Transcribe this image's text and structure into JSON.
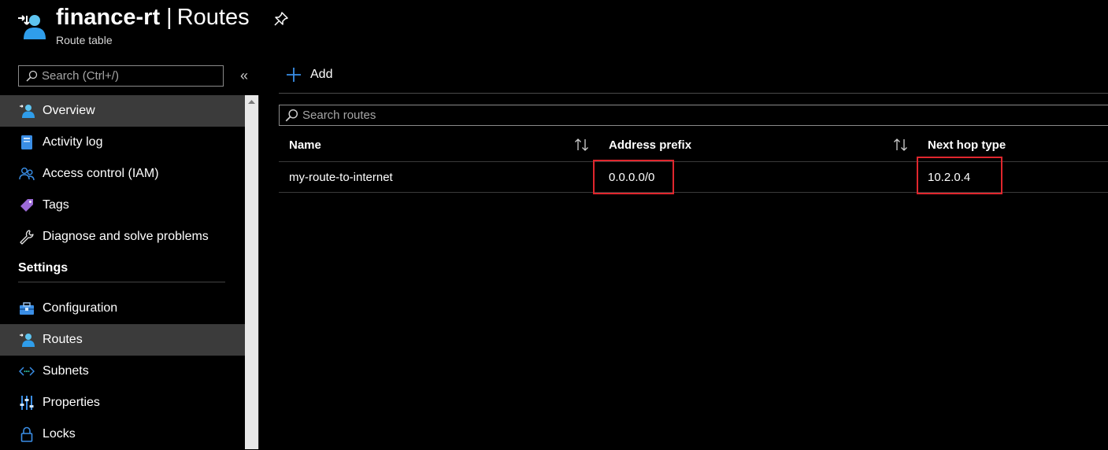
{
  "header": {
    "resource_name": "finance-rt",
    "separator": "|",
    "page": "Routes",
    "subtitle": "Route table"
  },
  "sidebar": {
    "search_placeholder": "Search (Ctrl+/)",
    "collapse_glyph": "«",
    "items": [
      {
        "label": "Overview",
        "icon": "route-table-icon",
        "active": false
      },
      {
        "label": "Activity log",
        "icon": "activity-log-icon",
        "active": false
      },
      {
        "label": "Access control (IAM)",
        "icon": "people-icon",
        "active": false
      },
      {
        "label": "Tags",
        "icon": "tag-icon",
        "active": false
      },
      {
        "label": "Diagnose and solve problems",
        "icon": "wrench-icon",
        "active": false
      }
    ],
    "settings_section": "Settings",
    "settings_items": [
      {
        "label": "Configuration",
        "icon": "toolbox-icon",
        "active": false
      },
      {
        "label": "Routes",
        "icon": "route-table-icon",
        "active": true
      },
      {
        "label": "Subnets",
        "icon": "subnet-icon",
        "active": false
      },
      {
        "label": "Properties",
        "icon": "sliders-icon",
        "active": false
      },
      {
        "label": "Locks",
        "icon": "lock-icon",
        "active": false
      }
    ]
  },
  "toolbar": {
    "add_label": "Add"
  },
  "routes": {
    "search_placeholder": "Search routes",
    "columns": [
      "Name",
      "Address prefix",
      "Next hop type"
    ],
    "rows": [
      {
        "name": "my-route-to-internet",
        "address_prefix": "0.0.0.0/0",
        "next_hop": "10.2.0.4"
      }
    ]
  },
  "colors": {
    "background": "#000000",
    "active_item": "#3b3b3b",
    "accent_blue": "#2f9dea",
    "highlight_red": "#e0262d"
  }
}
